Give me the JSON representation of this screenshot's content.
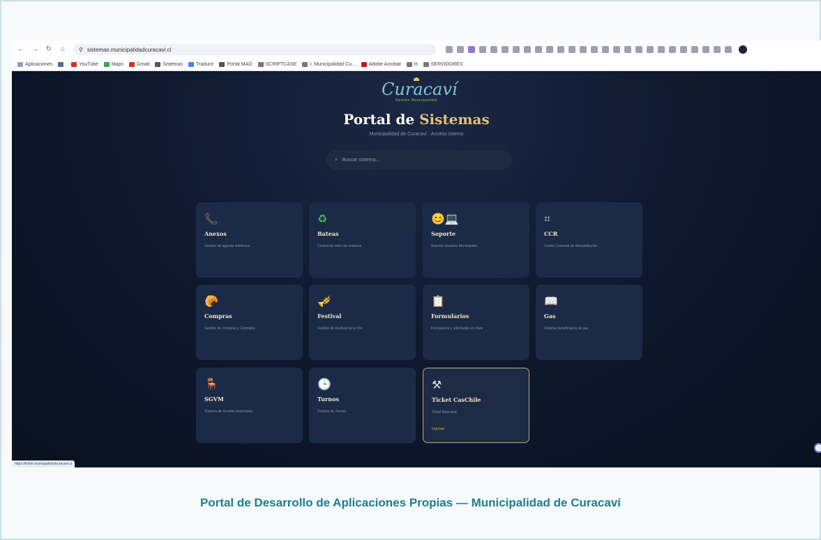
{
  "browser": {
    "url": "sistemas.municipalidadcuracavi.cl",
    "bookmarks": [
      "Aplicaciones",
      "YouTube",
      "Maps",
      "Gmail",
      "Sistemas",
      "Traducir",
      "Portal MAO",
      "SCRIPTCASE",
      "I. Municipalidad Cu...",
      "Adobe Acrobat",
      "H",
      "SERVIDORES"
    ],
    "status_url": "https://ticket.municipalidadcuracavi.cl"
  },
  "header": {
    "logo_text": "Curacaví",
    "logo_sub": "Gestión Municipalidad",
    "title_main": "Portal de ",
    "title_accent": "Sistemas",
    "subtitle": "Municipalidad de Curacaví · Acceso Interno"
  },
  "search": {
    "placeholder": "Buscar sistema..."
  },
  "cards": [
    {
      "icon": "📞",
      "title": "Anexos",
      "desc": "Gestión de agenda telefónica"
    },
    {
      "icon": "♻",
      "title": "Bateas",
      "desc": "Control de retiro de residuos"
    },
    {
      "icon": "😊💻",
      "title": "Soporte",
      "desc": "Soporte Usuarios Municipales"
    },
    {
      "icon": "⌗",
      "title": "CCR",
      "desc": "Centro Comunal de Rehabilitación"
    },
    {
      "icon": "🥐",
      "title": "Compras",
      "desc": "Gestión de Compras y Contratos"
    },
    {
      "icon": "🎺",
      "title": "Festival",
      "desc": "Gestión de Festival de la Voz"
    },
    {
      "icon": "📋",
      "title": "Formularios",
      "desc": "Formularios y solicitudes en línea"
    },
    {
      "icon": "📖",
      "title": "Gas",
      "desc": "Sistema beneficiarios de gas"
    },
    {
      "icon": "🪑",
      "title": "SGVM",
      "desc": "Sistema de Gestión Veterinaria"
    },
    {
      "icon": "🕒",
      "title": "Turnos",
      "desc": "Gestión de Turnos"
    },
    {
      "icon": "⚒",
      "title": "Ticket CasChile",
      "desc": "Ticket Municipal",
      "link": "Ingresar"
    }
  ],
  "caption": "Portal de Desarrollo de Aplicaciones Propias — Municipalidad de Curacaví",
  "colors": {
    "page_bg": "#0d1424",
    "card_bg": "#1b2a47",
    "accent_gold": "#e5c27a",
    "caption_teal": "#1f7d90"
  }
}
